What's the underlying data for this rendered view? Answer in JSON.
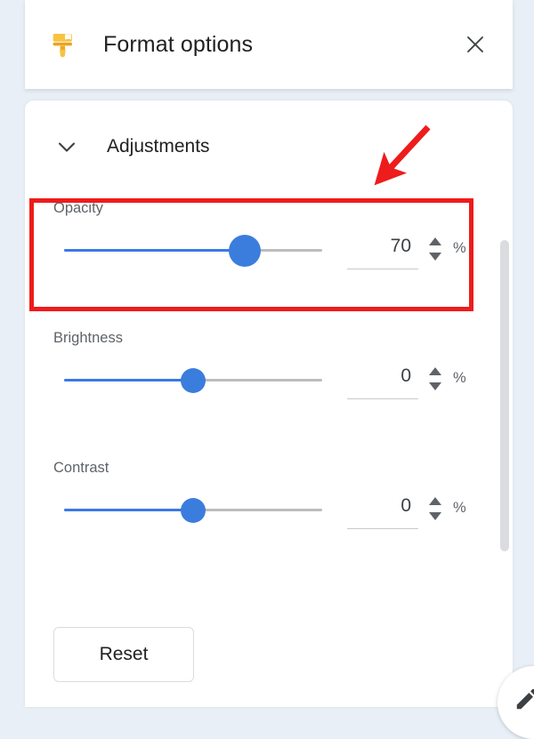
{
  "header": {
    "icon": "paint-format-brush-icon",
    "title": "Format options",
    "close_label": "×",
    "icon_color": "#f5b721"
  },
  "section": {
    "chevron": "chevron-down-icon",
    "title": "Adjustments",
    "expanded": "true"
  },
  "adjustments": [
    {
      "label": "Opacity",
      "value": "70",
      "unit": "%",
      "slider_percent": 70,
      "min": 0,
      "max": 100
    },
    {
      "label": "Brightness",
      "value": "0",
      "unit": "%",
      "slider_percent": 50,
      "min": -100,
      "max": 100
    },
    {
      "label": "Contrast",
      "value": "0",
      "unit": "%",
      "slider_percent": 50,
      "min": -100,
      "max": 100
    }
  ],
  "reset": {
    "label": "Reset"
  },
  "scrollbar": {
    "name": "vertical-scrollbar",
    "thumb_color": "#dadce0"
  },
  "fab": {
    "icon": "pencil-edit-icon"
  },
  "annotation": {
    "highlight_color": "#ef1b1b",
    "highlight_target": "Opacity",
    "arrow_color": "#ee1c1c",
    "arrow_direction": "down-left"
  },
  "colors": {
    "page_background": "#e9eff6",
    "panel_background": "#ffffff",
    "slider_fill": "#3b78e7",
    "slider_thumb": "#3b7ddd",
    "slider_track": "#bdbdbd",
    "label_text": "#5f6368",
    "title_text": "#202124"
  }
}
